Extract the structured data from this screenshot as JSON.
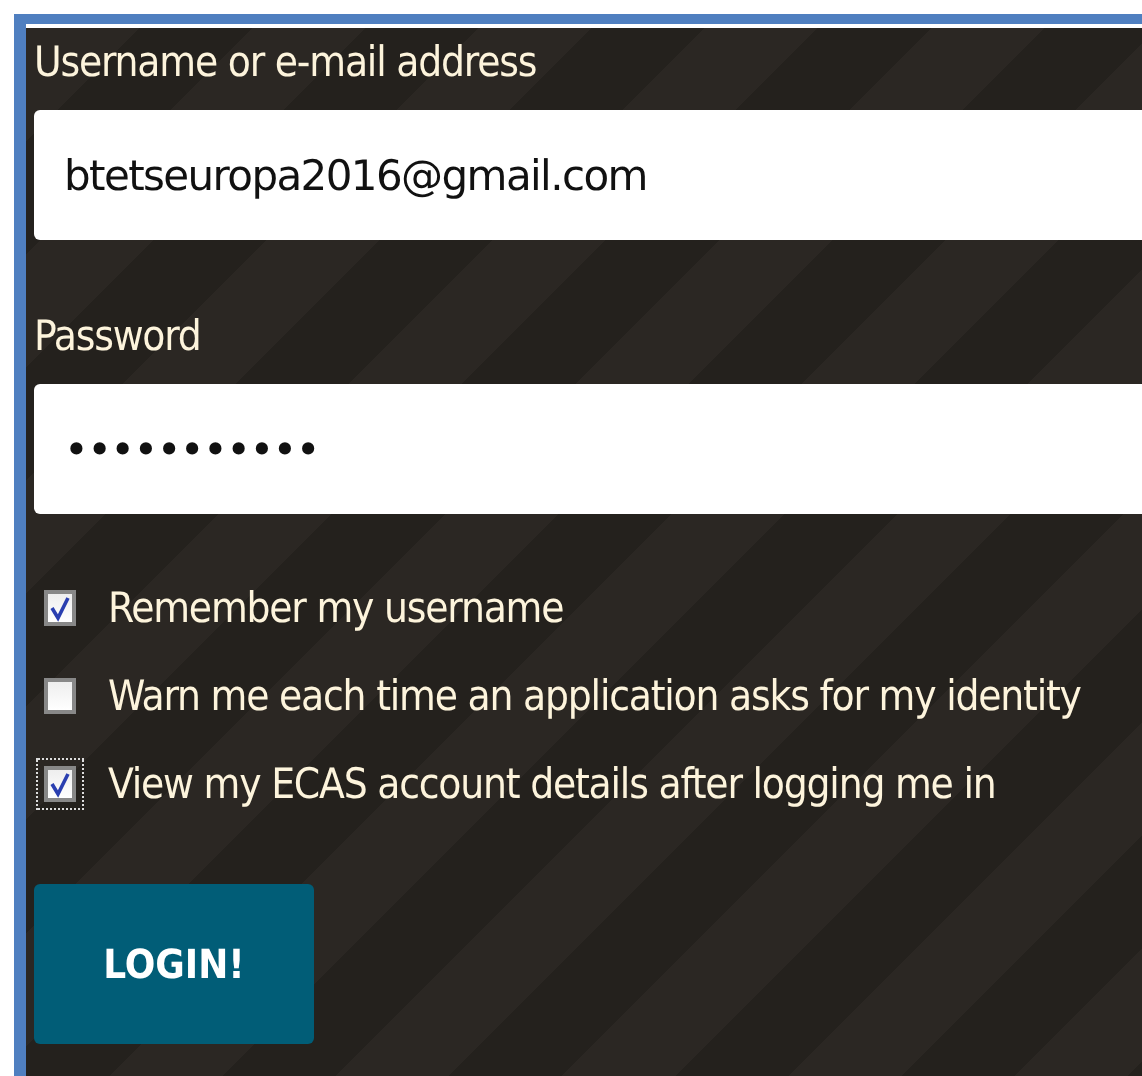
{
  "form": {
    "fields": [
      {
        "label": "Username or e-mail address",
        "value": "btetseuropa2016@gmail.com"
      },
      {
        "label": "Password",
        "value": "•••••••••••"
      }
    ],
    "options": [
      {
        "label": "Remember my username",
        "checked": true,
        "focused": false
      },
      {
        "label": "Warn me each time an application asks for my identity",
        "checked": false,
        "focused": false
      },
      {
        "label": "View my ECAS account details after logging me in",
        "checked": true,
        "focused": true
      }
    ],
    "button": "LOGIN!"
  }
}
